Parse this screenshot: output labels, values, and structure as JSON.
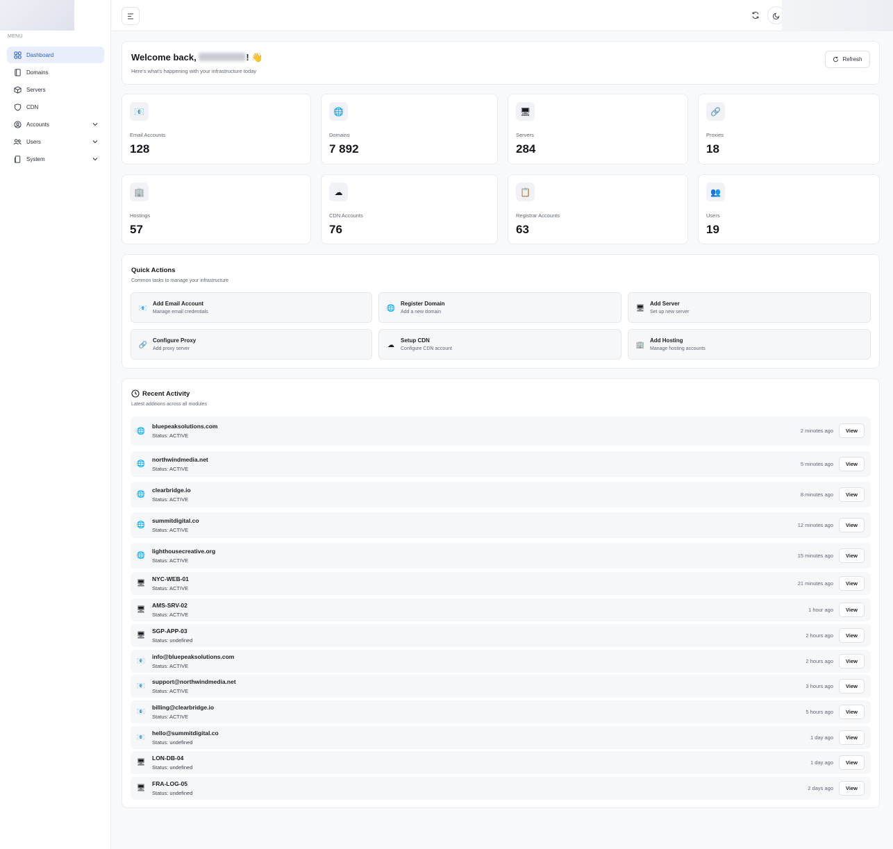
{
  "sidebar": {
    "menu_label": "MENU",
    "items": [
      {
        "label": "Dashboard",
        "icon": "grid-icon",
        "active": true
      },
      {
        "label": "Domains",
        "icon": "book-icon"
      },
      {
        "label": "Servers",
        "icon": "box-icon"
      },
      {
        "label": "CDN",
        "icon": "shield-icon"
      },
      {
        "label": "Accounts",
        "icon": "user-circle-icon",
        "expandable": true
      },
      {
        "label": "Users",
        "icon": "users-icon",
        "expandable": true
      },
      {
        "label": "System",
        "icon": "document-icon",
        "expandable": true
      }
    ]
  },
  "welcome": {
    "title_prefix": "Welcome back, ",
    "title_suffix": "! 👋",
    "subtitle": "Here's what's happening with your infrastructure today",
    "refresh_label": "Refresh"
  },
  "stats": [
    {
      "label": "Email Accounts",
      "value": "128",
      "icon": "📧"
    },
    {
      "label": "Domains",
      "value": "7 892",
      "icon": "🌐"
    },
    {
      "label": "Servers",
      "value": "284",
      "icon": "🖥"
    },
    {
      "label": "Proxies",
      "value": "18",
      "icon": "🔗"
    },
    {
      "label": "Hostings",
      "value": "57",
      "icon": "🏢"
    },
    {
      "label": "CDN Accounts",
      "value": "76",
      "icon": "☁"
    },
    {
      "label": "Registrar Accounts",
      "value": "63",
      "icon": "📋"
    },
    {
      "label": "Users",
      "value": "19",
      "icon": "👥"
    }
  ],
  "quick_actions": {
    "title": "Quick Actions",
    "subtitle": "Common tasks to manage your infrastructure",
    "items": [
      {
        "name": "Add Email Account",
        "desc": "Manage email credentials",
        "icon": "📧"
      },
      {
        "name": "Register Domain",
        "desc": "Add a new domain",
        "icon": "🌐"
      },
      {
        "name": "Add Server",
        "desc": "Set up new server",
        "icon": "🖥"
      },
      {
        "name": "Configure Proxy",
        "desc": "Add proxy server",
        "icon": "🔗"
      },
      {
        "name": "Setup CDN",
        "desc": "Configure CDN account",
        "icon": "☁"
      },
      {
        "name": "Add Hosting",
        "desc": "Manage hosting accounts",
        "icon": "🏢"
      }
    ]
  },
  "recent_activity": {
    "title": "Recent Activity",
    "subtitle": "Latest additions across all modules",
    "view_label": "View",
    "rows": [
      {
        "name": "bluepeaksolutions.com",
        "status": "Status: ACTIVE",
        "time": "2 minutes ago",
        "icon": "🌐"
      },
      {
        "name": "northwindmedia.net",
        "status": "Status: ACTIVE",
        "time": "5 minutes ago",
        "icon": "🌐"
      },
      {
        "name": "clearbridge.io",
        "status": "Status: ACTIVE",
        "time": "8 minutes ago",
        "icon": "🌐"
      },
      {
        "name": "summitdigital.co",
        "status": "Status: ACTIVE",
        "time": "12 minutes ago",
        "icon": "🌐"
      },
      {
        "name": "lighthousecreative.org",
        "status": "Status: ACTIVE",
        "time": "15 minutes ago",
        "icon": "🌐"
      },
      {
        "name": "NYC-WEB-01",
        "status": "Status: ACTIVE",
        "time": "21 minutes ago",
        "icon": "🖥"
      },
      {
        "name": "AMS-SRV-02",
        "status": "Status: ACTIVE",
        "time": "1 hour ago",
        "icon": "🖥"
      },
      {
        "name": "SGP-APP-03",
        "status": "Status: undefined",
        "time": "2 hours ago",
        "icon": "🖥"
      },
      {
        "name": "info@bluepeaksolutions.com",
        "status": "Status: ACTIVE",
        "time": "2 hours ago",
        "icon": "📧"
      },
      {
        "name": "support@northwindmedia.net",
        "status": "Status: ACTIVE",
        "time": "3 hours ago",
        "icon": "📧"
      },
      {
        "name": "billing@clearbridge.io",
        "status": "Status: ACTIVE",
        "time": "5 hours ago",
        "icon": "📧"
      },
      {
        "name": "hello@summitdigital.co",
        "status": "Status: undefined",
        "time": "1 day ago",
        "icon": "📧"
      },
      {
        "name": "LON-DB-04",
        "status": "Status: undefined",
        "time": "1 day ago",
        "icon": "🖥"
      },
      {
        "name": "FRA-LOG-05",
        "status": "Status: undefined",
        "time": "2 days ago",
        "icon": "🖥"
      }
    ]
  }
}
